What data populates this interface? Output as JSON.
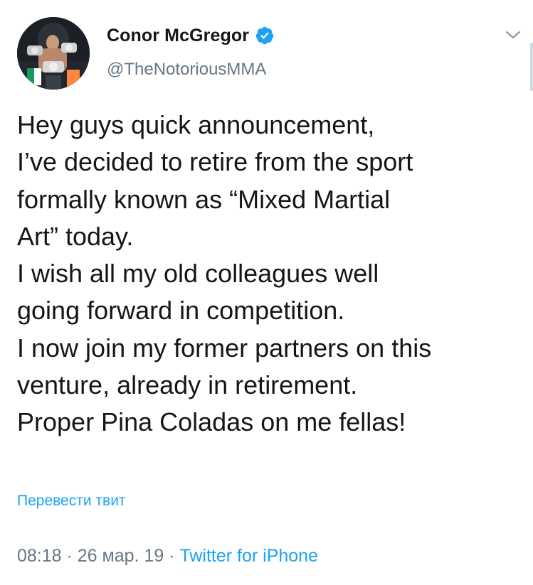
{
  "author": {
    "display_name": "Conor McGregor",
    "handle": "@TheNotoriousMMA",
    "verified": true,
    "verified_icon": "verified-badge-icon",
    "avatar": "profile-photo"
  },
  "menu_icon": "chevron-down-icon",
  "tweet": {
    "lines": [
      "Hey guys quick announcement,",
      "I’ve decided to retire from the sport",
      "formally known as “Mixed Martial",
      "Art” today.",
      "I wish all my old colleagues well",
      "going forward in competition.",
      "I now join my former partners on this",
      "venture, already in retirement.",
      "Proper Pina Coladas on me fellas!"
    ]
  },
  "translate_label": "Перевести твит",
  "meta": {
    "time": "08:18",
    "separator": " · ",
    "date": "26 мар. 19",
    "source": "Twitter for iPhone"
  },
  "colors": {
    "link": "#1da1f2",
    "secondary_text": "#657786",
    "primary_text": "#14171a"
  }
}
